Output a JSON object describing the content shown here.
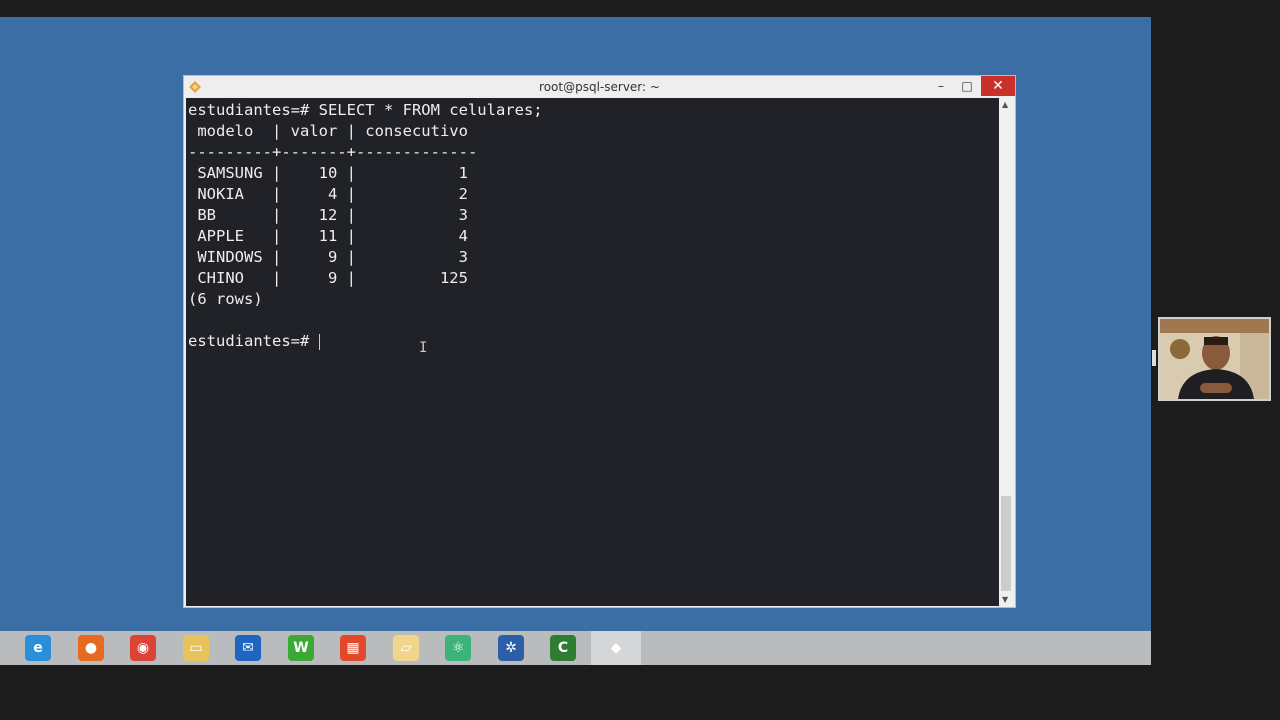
{
  "window": {
    "title": "root@psql-server: ~",
    "min_glyph": "–",
    "max_glyph": "□",
    "close_glyph": "✕"
  },
  "terminal": {
    "lines": [
      "estudiantes=# SELECT * FROM celulares;",
      " modelo  | valor | consecutivo",
      "---------+-------+-------------",
      " SAMSUNG |    10 |           1",
      " NOKIA   |     4 |           2",
      " BB      |    12 |           3",
      " APPLE   |    11 |           4",
      " WINDOWS |     9 |           3",
      " CHINO   |     9 |         125",
      "(6 rows)",
      ""
    ],
    "prompt": "estudiantes=# "
  },
  "taskbar": {
    "icons": [
      {
        "name": "internet-explorer-icon",
        "color": "#2a8fd8",
        "glyph": "e"
      },
      {
        "name": "firefox-icon",
        "color": "#e66a1f",
        "glyph": "●"
      },
      {
        "name": "chrome-icon",
        "color": "#db4437",
        "glyph": "◉"
      },
      {
        "name": "file-explorer-icon",
        "color": "#e8c25a",
        "glyph": "▭"
      },
      {
        "name": "mail-icon",
        "color": "#1f66c1",
        "glyph": "✉"
      },
      {
        "name": "word-icon",
        "color": "#3aaa35",
        "glyph": "W"
      },
      {
        "name": "app-grid-icon",
        "color": "#e04a2a",
        "glyph": "▦"
      },
      {
        "name": "folder-icon",
        "color": "#f0d58a",
        "glyph": "▱"
      },
      {
        "name": "atom-icon",
        "color": "#3bb37a",
        "glyph": "⚛"
      },
      {
        "name": "gear-flower-icon",
        "color": "#2d5ea8",
        "glyph": "✲"
      },
      {
        "name": "camtasia-icon",
        "color": "#2e7d32",
        "glyph": "C"
      },
      {
        "name": "terminal-app-icon",
        "color": "#d4d6d8",
        "glyph": "◆"
      }
    ]
  }
}
